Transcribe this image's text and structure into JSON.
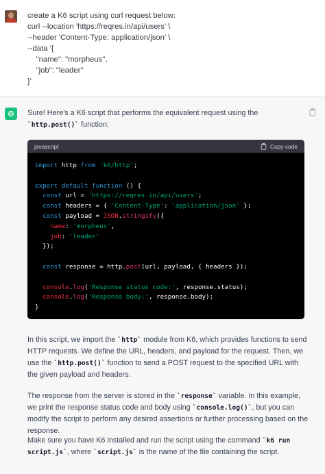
{
  "user": {
    "avatar": "user-avatar-photo",
    "prompt": "create a K6 script using curl request below:\ncurl --location 'https://reqres.in/api/users' \\\n--header 'Content-Type: application/json' \\\n--data '{\n    \"name\": \"morpheus\",\n    \"job\": \"leader\"\n}'"
  },
  "assistant": {
    "icon": "openai-logo-icon",
    "intro_before": "Sure! Here's a K6 script that performs the equivalent request using the ",
    "intro_code": "`http.post()`",
    "intro_after": " function:",
    "code_block": {
      "language": "javascript",
      "copy_label": "Copy code",
      "copy_icon": "clipboard-icon"
    },
    "para1": {
      "a": "In this script, we import the ",
      "code1": "`http`",
      "b": " module from K6, which provides functions to send HTTP requests. We define the URL, headers, and payload for the request. Then, we use the ",
      "code2": "`http.post()`",
      "c": " function to send a POST request to the specified URL with the given payload and headers."
    },
    "para2": {
      "a": "The response from the server is stored in the ",
      "code1": "`response`",
      "b": " variable. In this example, we print the response status code and body using ",
      "code2": "`console.log()`",
      "c": ", but you can modify the script to perform any desired assertions or further processing based on the response."
    },
    "para3": {
      "a": "Make sure you have K6 installed and run the script using the command ",
      "code1": "`k6 run script.js`",
      "b": ", where ",
      "code2": "`script.js`",
      "c": " is the name of the file containing the script."
    }
  },
  "colors": {
    "assistant_bg": "#f7f7f8",
    "code_bg": "#000000",
    "code_header_bg": "#343541",
    "gpt_green": "#19c37d",
    "keyword": "#2e95d3",
    "string": "#00a67d",
    "function": "#df3079"
  }
}
